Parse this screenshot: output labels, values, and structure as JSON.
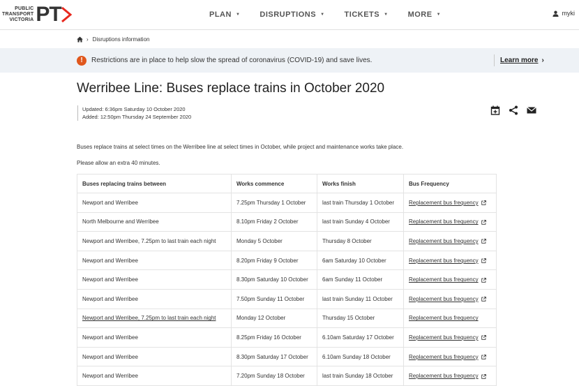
{
  "header": {
    "logo_lines": [
      "PUBLIC",
      "TRANSPORT",
      "VICTORIA"
    ],
    "logo_mark": "PT",
    "nav": [
      "PLAN",
      "DISRUPTIONS",
      "TICKETS",
      "MORE"
    ],
    "user_label": "myki"
  },
  "breadcrumb": {
    "home_icon": "home-icon",
    "current": "Disruptions information"
  },
  "banner": {
    "text": "Restrictions are in place to help slow the spread of coronavirus (COVID-19) and save lives.",
    "link": "Learn more"
  },
  "page": {
    "title": "Werribee Line: Buses replace trains in October 2020",
    "updated": "Updated: 6:36pm Saturday 10 October 2020",
    "added": "Added: 12:50pm Thursday 24 September 2020",
    "description": "Buses replace trains at select times on the Werribee line at select times in October, while project and maintenance works take place.",
    "note": "Please allow an extra 40 minutes."
  },
  "table": {
    "headers": [
      "Buses replacing trains between",
      "Works commence",
      "Works finish",
      "Bus Frequency"
    ],
    "link_text": "Replacement bus frequency",
    "rows": [
      [
        "Newport and Werribee",
        "7.25pm Thursday 1 October",
        "last train Thursday 1 October"
      ],
      [
        "North Melbourne and Werribee",
        "8.10pm Friday 2 October",
        "last train Sunday 4 October"
      ],
      [
        "Newport and Werribee, 7.25pm to last train each night",
        "Monday 5 October",
        "Thursday 8 October"
      ],
      [
        "Newport and Werribee",
        "8.20pm Friday 9 October",
        "6am Saturday 10 October"
      ],
      [
        "Newport and Werribee",
        "8.30pm Saturday 10 October",
        "6am Sunday 11 October"
      ],
      [
        "Newport and Werribee",
        "7.50pm Sunday 11 October",
        "last train Sunday 11 October"
      ],
      [
        "Newport and Werribee,  7.25pm to last train each night",
        "Monday 12 October",
        "Thursday 15 October"
      ],
      [
        "Newport and Werribee",
        "8.25pm Friday 16 October",
        "6.10am Saturday 17 October"
      ],
      [
        "Newport and Werribee",
        "8.30pm Saturday 17 October",
        "6.10am Sunday 18 October"
      ],
      [
        "Newport and Werribee",
        "7.20pm Sunday 18 October",
        "last train Sunday 18 October"
      ]
    ]
  }
}
